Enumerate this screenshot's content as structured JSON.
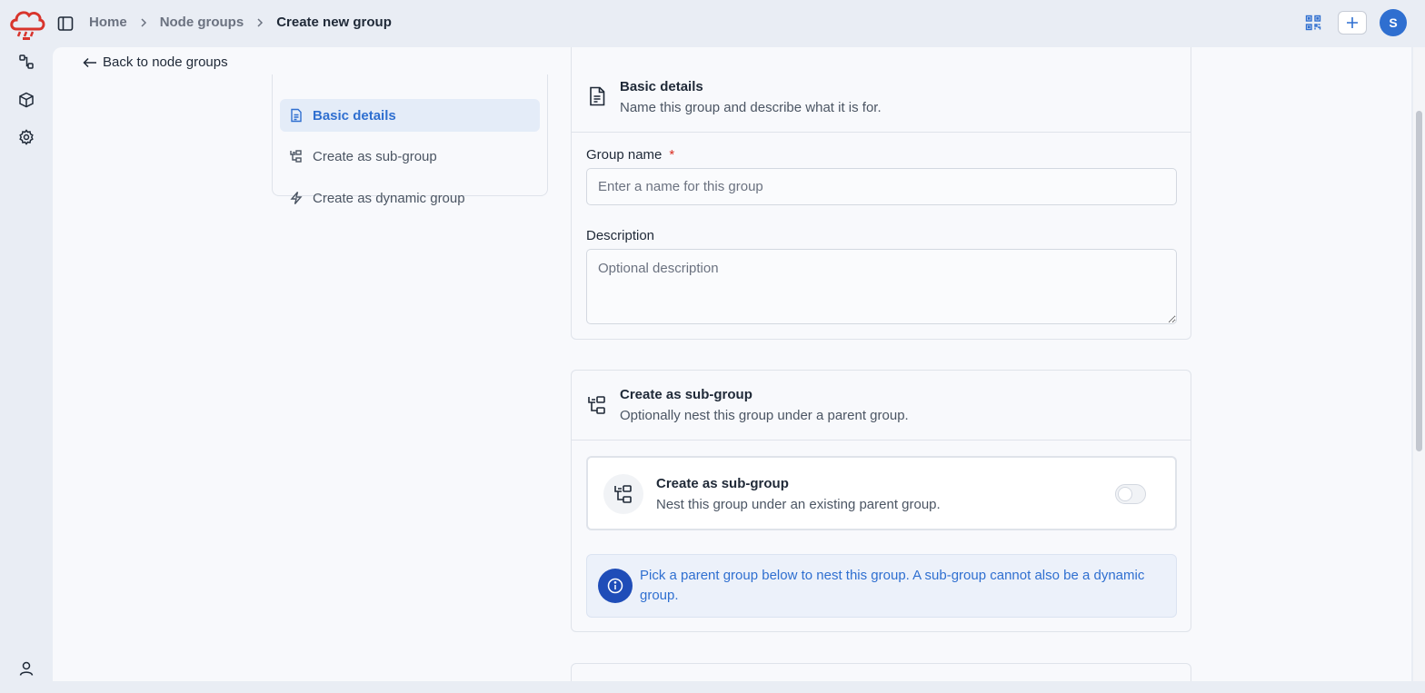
{
  "app": {
    "logo": "node-red-cloud-logo"
  },
  "breadcrumb": {
    "items": [
      "Home",
      "Node groups",
      "Create new group"
    ]
  },
  "user": {
    "avatar_initial": "S"
  },
  "nav": {
    "back_label": "Back to node groups",
    "sections": [
      {
        "label": "Basic details",
        "icon": "document-icon",
        "active": true
      },
      {
        "label": "Create as sub-group",
        "icon": "hierarchy-icon",
        "active": false
      },
      {
        "label": "Create as dynamic group",
        "icon": "lightning-icon",
        "active": false
      }
    ]
  },
  "basic": {
    "title": "Basic details",
    "subtitle": "Name this group and describe what it is for.",
    "group_name_label": "Group name",
    "required_mark": "*",
    "group_name_placeholder": "Enter a name for this group",
    "description_label": "Description",
    "description_placeholder": "Optional description"
  },
  "subgroup": {
    "title": "Create as sub-group",
    "subtitle": "Optionally nest this group under a parent group.",
    "toggle_title": "Create as sub-group",
    "toggle_subtitle": "Nest this group under an existing parent group.",
    "toggle_on": false,
    "info": "Pick a parent group below to nest this group. A sub-group cannot also be a dynamic group."
  },
  "colors": {
    "accent": "#2f6fd0",
    "info_icon_bg": "#1f4db8",
    "required": "#d92d20",
    "logo_red": "#d8342c"
  }
}
